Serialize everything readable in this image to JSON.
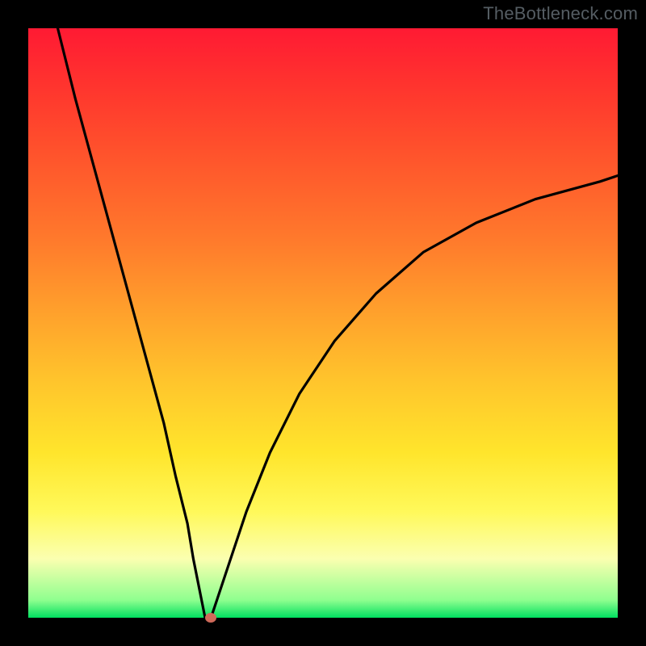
{
  "watermark": "TheBottleneck.com",
  "colors": {
    "gradient_top": "#ff1a33",
    "gradient_bottom": "#00e060",
    "curve": "#000000",
    "marker": "#cf6a5a",
    "frame": "#000000"
  },
  "chart_data": {
    "type": "line",
    "title": "",
    "xlabel": "",
    "ylabel": "",
    "xlim": [
      0,
      100
    ],
    "ylim": [
      0,
      100
    ],
    "grid": false,
    "legend": false,
    "description": "V-shaped bottleneck curve with sharp minimum; background is a vertical rainbow gradient from red (high bottleneck) to green (no bottleneck).",
    "series": [
      {
        "name": "bottleneck-curve",
        "x": [
          5,
          8,
          11,
          14,
          17,
          20,
          23,
          25,
          27,
          28,
          29,
          30,
          31,
          32,
          34,
          37,
          41,
          46,
          52,
          59,
          67,
          76,
          86,
          97,
          100
        ],
        "y": [
          100,
          88,
          77,
          66,
          55,
          44,
          33,
          24,
          16,
          10,
          5,
          0,
          0,
          3,
          9,
          18,
          28,
          38,
          47,
          55,
          62,
          67,
          71,
          74,
          75
        ]
      }
    ],
    "minimum_marker": {
      "x": 31,
      "y": 0
    }
  }
}
